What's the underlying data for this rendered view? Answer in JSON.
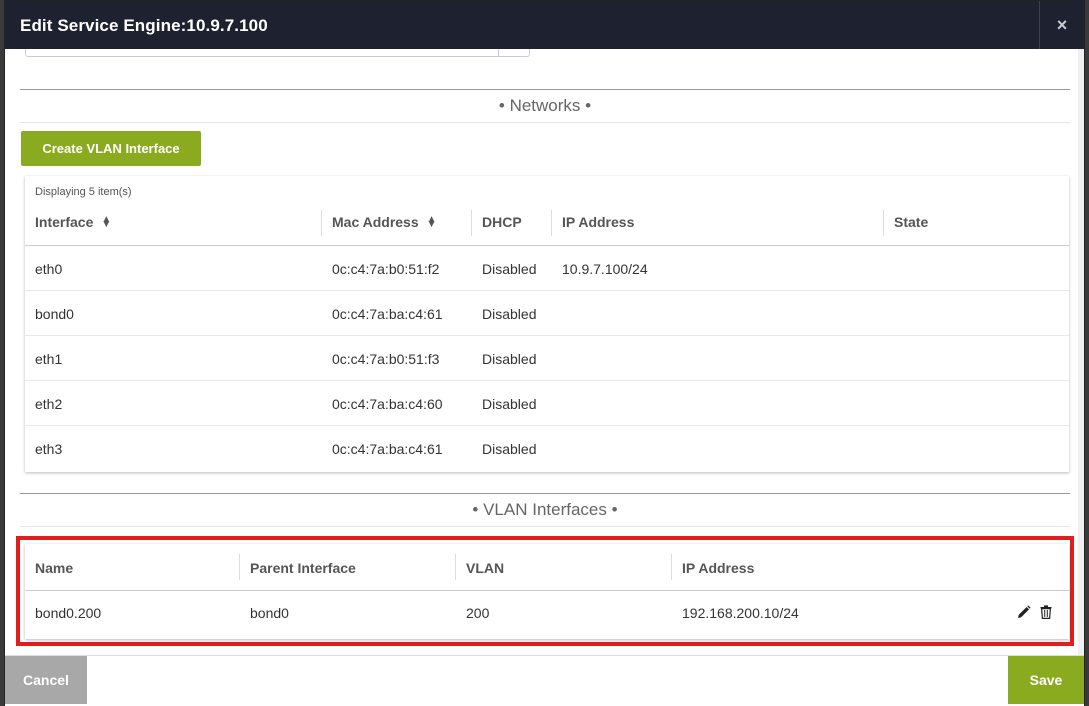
{
  "modal": {
    "title": "Edit Service Engine:",
    "title_ip": "10.9.7.100",
    "close_glyph": "×"
  },
  "networks": {
    "section_title": "• Networks •",
    "create_button": "Create VLAN Interface",
    "displaying": "Displaying 5 item(s)",
    "columns": [
      "Interface",
      "Mac Address",
      "DHCP",
      "IP Address",
      "State"
    ],
    "rows": [
      {
        "interface": "eth0",
        "mac": "0c:c4:7a:b0:51:f2",
        "dhcp": "Disabled",
        "ip": "10.9.7.100/24",
        "state": ""
      },
      {
        "interface": "bond0",
        "mac": "0c:c4:7a:ba:c4:61",
        "dhcp": "Disabled",
        "ip": "",
        "state": ""
      },
      {
        "interface": "eth1",
        "mac": "0c:c4:7a:b0:51:f3",
        "dhcp": "Disabled",
        "ip": "",
        "state": ""
      },
      {
        "interface": "eth2",
        "mac": "0c:c4:7a:ba:c4:60",
        "dhcp": "Disabled",
        "ip": "",
        "state": ""
      },
      {
        "interface": "eth3",
        "mac": "0c:c4:7a:ba:c4:61",
        "dhcp": "Disabled",
        "ip": "",
        "state": ""
      }
    ]
  },
  "vlan": {
    "section_title": "• VLAN Interfaces •",
    "columns": [
      "Name",
      "Parent Interface",
      "VLAN",
      "IP Address"
    ],
    "rows": [
      {
        "name": "bond0.200",
        "parent": "bond0",
        "vlan": "200",
        "ip": "192.168.200.10/24"
      }
    ],
    "icons": [
      "pencil-icon",
      "trash-icon"
    ]
  },
  "footer": {
    "cancel_label": "Cancel",
    "save_label": "Save"
  },
  "colors": {
    "accent_green": "#8aab1f",
    "header_bg": "#1e2230",
    "highlight_red": "#e41c1c",
    "cancel_gray": "#a8a8a8"
  }
}
